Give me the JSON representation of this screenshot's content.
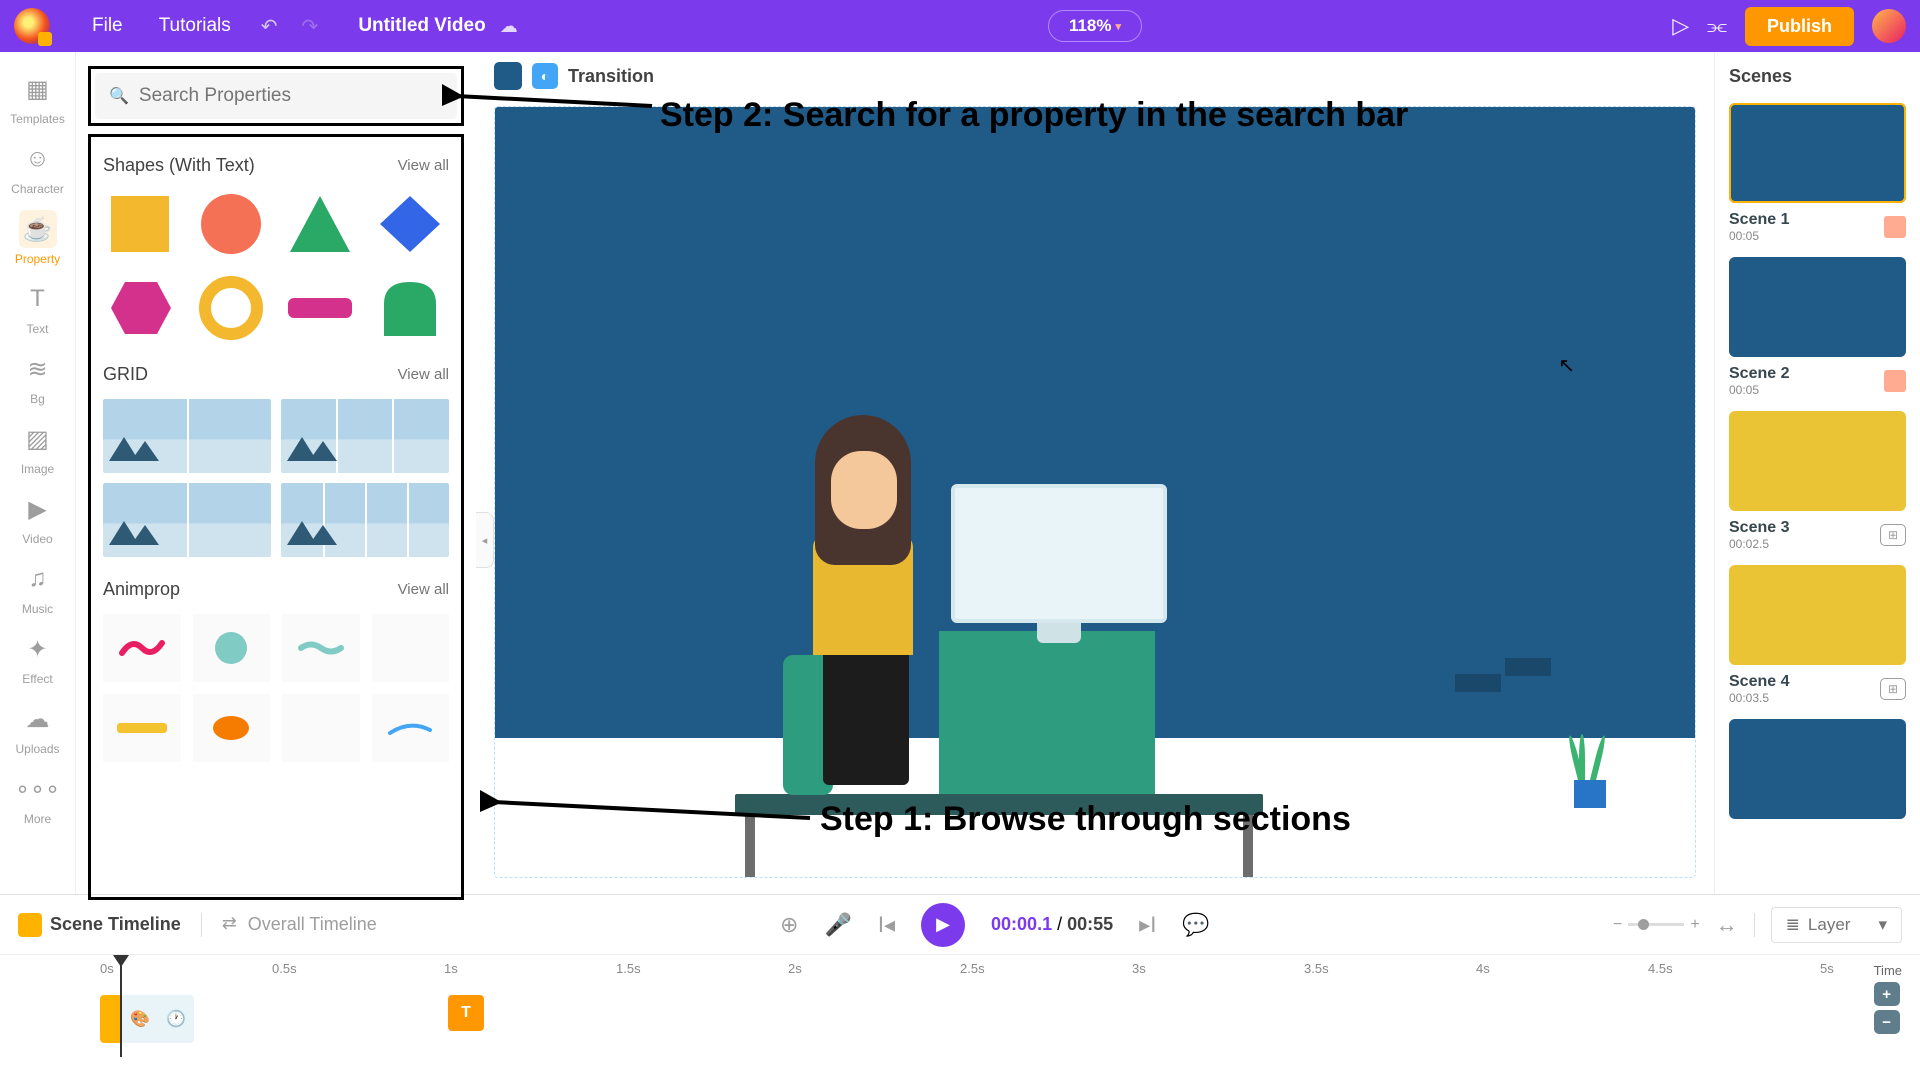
{
  "topbar": {
    "file": "File",
    "tutorials": "Tutorials",
    "title": "Untitled Video",
    "zoom": "118%",
    "publish": "Publish"
  },
  "nav": [
    {
      "key": "templates",
      "label": "Templates",
      "icon": "▦"
    },
    {
      "key": "character",
      "label": "Character",
      "icon": "☺"
    },
    {
      "key": "property",
      "label": "Property",
      "icon": "☕"
    },
    {
      "key": "text",
      "label": "Text",
      "icon": "T"
    },
    {
      "key": "bg",
      "label": "Bg",
      "icon": "≋"
    },
    {
      "key": "image",
      "label": "Image",
      "icon": "▨"
    },
    {
      "key": "video",
      "label": "Video",
      "icon": "▶"
    },
    {
      "key": "music",
      "label": "Music",
      "icon": "♫"
    },
    {
      "key": "effect",
      "label": "Effect",
      "icon": "✦"
    },
    {
      "key": "uploads",
      "label": "Uploads",
      "icon": "☁"
    },
    {
      "key": "more",
      "label": "More",
      "icon": "∘∘∘"
    }
  ],
  "activeNav": "property",
  "search": {
    "placeholder": "Search Properties"
  },
  "sections": {
    "shapes": {
      "title": "Shapes (With Text)",
      "viewall": "View all"
    },
    "grid": {
      "title": "GRID",
      "viewall": "View all"
    },
    "animprop": {
      "title": "Animprop",
      "viewall": "View all"
    }
  },
  "canvasHeader": {
    "transition": "Transition"
  },
  "scenesTitle": "Scenes",
  "scenes": [
    {
      "name": "Scene 1",
      "dur": "00:05",
      "color": "c1",
      "badge": "pink",
      "sel": true
    },
    {
      "name": "Scene 2",
      "dur": "00:05",
      "color": "c1",
      "badge": "pink"
    },
    {
      "name": "Scene 3",
      "dur": "00:02.5",
      "color": "c2",
      "badge": "icon"
    },
    {
      "name": "Scene 4",
      "dur": "00:03.5",
      "color": "c2",
      "badge": "icon"
    },
    {
      "name": "",
      "dur": "",
      "color": "c1"
    }
  ],
  "timeline": {
    "sceneTab": "Scene Timeline",
    "overallTab": "Overall Timeline",
    "current": "00:00.1",
    "total": "00:55",
    "ticks": [
      "0s",
      "0.5s",
      "1s",
      "1.5s",
      "2s",
      "2.5s",
      "3s",
      "3.5s",
      "4s",
      "4.5s",
      "5s"
    ],
    "timeLabel": "Time",
    "layer": "Layer",
    "txtClip": "T"
  },
  "annotations": {
    "step1": "Step 1: Browse through sections",
    "step2": "Step 2: Search for a property in the search bar"
  }
}
